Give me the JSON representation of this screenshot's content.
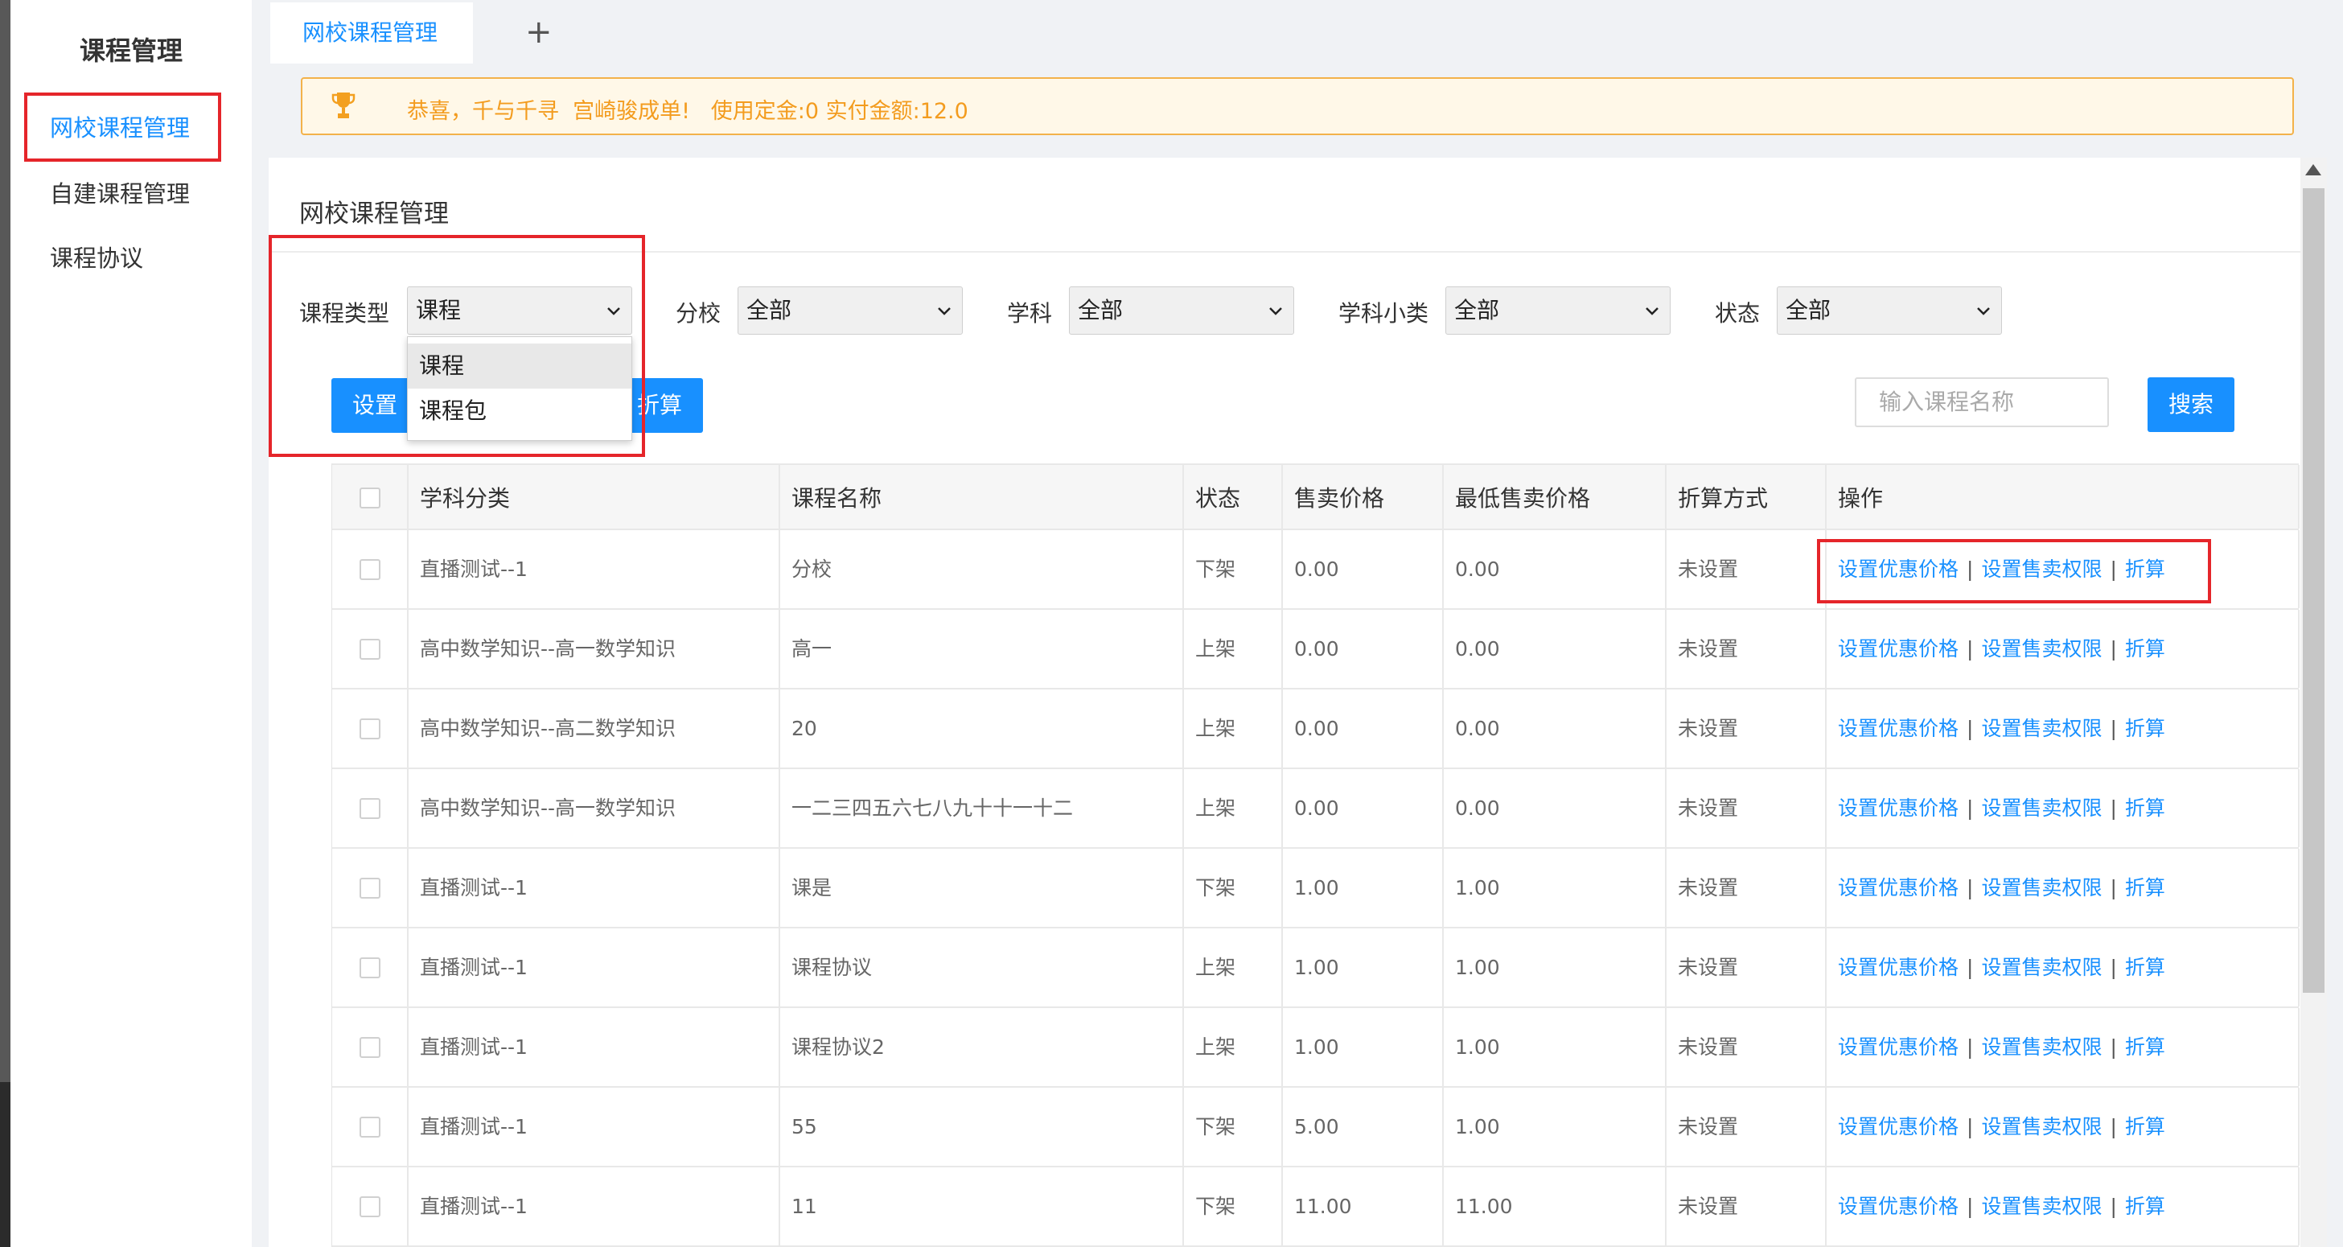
{
  "sidebar": {
    "title": "课程管理",
    "items": [
      {
        "label": "网校课程管理",
        "active": true
      },
      {
        "label": "自建课程管理",
        "active": false
      },
      {
        "label": "课程协议",
        "active": false
      }
    ]
  },
  "tabs": {
    "items": [
      {
        "label": "网校课程管理"
      }
    ],
    "add_label": "+"
  },
  "notice": {
    "icon": "trophy-icon",
    "text": "恭喜，千与千寻  宫崎骏成单!   使用定金:0 实付金额:12.0"
  },
  "panel": {
    "title": "网校课程管理"
  },
  "filters": {
    "course_type": {
      "label": "课程类型",
      "value": "课程",
      "options": [
        "课程",
        "课程包"
      ]
    },
    "branch": {
      "label": "分校",
      "value": "全部"
    },
    "subject": {
      "label": "学科",
      "value": "全部"
    },
    "subject_sub": {
      "label": "学科小类",
      "value": "全部"
    },
    "status": {
      "label": "状态",
      "value": "全部"
    }
  },
  "actions": {
    "set_button_left": "设置",
    "set_button_right": "折算",
    "search_placeholder": "输入课程名称",
    "search_button": "搜索"
  },
  "table": {
    "headers": [
      "学科分类",
      "课程名称",
      "状态",
      "售卖价格",
      "最低售卖价格",
      "折算方式",
      "操作"
    ],
    "rows": [
      [
        "直播测试--1",
        "分校",
        "下架",
        "0.00",
        "0.00",
        "未设置"
      ],
      [
        "高中数学知识--高一数学知识",
        "高一",
        "上架",
        "0.00",
        "0.00",
        "未设置"
      ],
      [
        "高中数学知识--高二数学知识",
        "20",
        "上架",
        "0.00",
        "0.00",
        "未设置"
      ],
      [
        "高中数学知识--高一数学知识",
        "一二三四五六七八九十十一十二",
        "上架",
        "0.00",
        "0.00",
        "未设置"
      ],
      [
        "直播测试--1",
        "课是",
        "下架",
        "1.00",
        "1.00",
        "未设置"
      ],
      [
        "直播测试--1",
        "课程协议",
        "上架",
        "1.00",
        "1.00",
        "未设置"
      ],
      [
        "直播测试--1",
        "课程协议2",
        "上架",
        "1.00",
        "1.00",
        "未设置"
      ],
      [
        "直播测试--1",
        "55",
        "下架",
        "5.00",
        "1.00",
        "未设置"
      ],
      [
        "直播测试--1",
        "11",
        "下架",
        "11.00",
        "11.00",
        "未设置"
      ]
    ],
    "row_actions": [
      "设置优惠价格",
      "设置售卖权限",
      "折算"
    ],
    "separator": "|"
  },
  "colors": {
    "accent": "#1890ff",
    "highlight_box": "#e5252a",
    "notice_border": "#f3b24a",
    "notice_text": "#f39c1f"
  }
}
